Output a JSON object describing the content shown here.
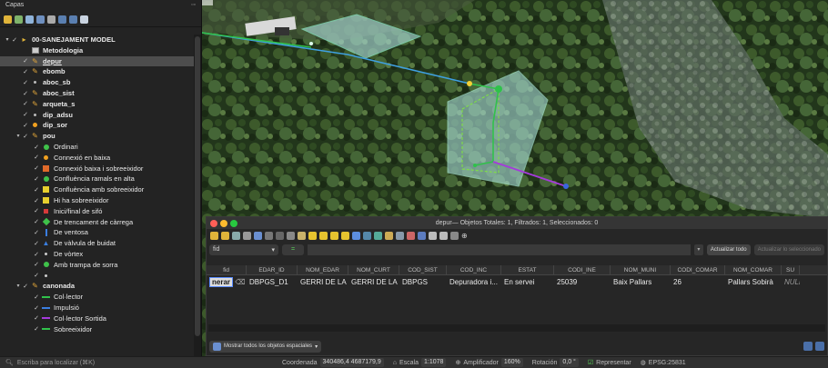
{
  "layers_panel": {
    "title": "Capas",
    "tree": [
      {
        "label": "00-SANEJAMENT MODEL",
        "indent": 0,
        "twisty": "▾",
        "check": "✓",
        "sym": "folder",
        "bold": true
      },
      {
        "label": "Metodologia",
        "indent": 1,
        "twisty": "",
        "check": "",
        "sym": "table",
        "bold": true
      },
      {
        "label": "depur",
        "indent": 1,
        "twisty": "",
        "check": "✓",
        "sym": "pencil",
        "bold": true,
        "selected": true,
        "underline": true
      },
      {
        "label": "ebomb",
        "indent": 1,
        "twisty": "",
        "check": "✓",
        "sym": "pencil",
        "bold": true
      },
      {
        "label": "aboc_sb",
        "indent": 1,
        "twisty": "",
        "check": "✓",
        "sym": "dot",
        "bold": true
      },
      {
        "label": "aboc_sist",
        "indent": 1,
        "twisty": "",
        "check": "✓",
        "sym": "pencil",
        "bold": true
      },
      {
        "label": "arqueta_s",
        "indent": 1,
        "twisty": "",
        "check": "✓",
        "sym": "pencil",
        "bold": true
      },
      {
        "label": "dip_adsu",
        "indent": 1,
        "twisty": "",
        "check": "✓",
        "sym": "dot",
        "bold": true
      },
      {
        "label": "dip_sor",
        "indent": 1,
        "twisty": "",
        "check": "✓",
        "sym": "dot-orange",
        "bold": true
      },
      {
        "label": "pou",
        "indent": 1,
        "twisty": "▾",
        "check": "✓",
        "sym": "pencil",
        "bold": true
      },
      {
        "label": "Ordinari",
        "indent": 2,
        "twisty": "",
        "check": "✓",
        "sym": "dot-green",
        "bold": false
      },
      {
        "label": "Connexió en baixa",
        "indent": 2,
        "twisty": "",
        "check": "✓",
        "sym": "dot-orange",
        "bold": false
      },
      {
        "label": "Connexió baixa i sobreeixidor",
        "indent": 2,
        "twisty": "",
        "check": "✓",
        "sym": "sq-orange",
        "bold": false
      },
      {
        "label": "Confluència ramals en alta",
        "indent": 2,
        "twisty": "",
        "check": "✓",
        "sym": "dot-green",
        "bold": false
      },
      {
        "label": "Confluència amb sobreeixidor",
        "indent": 2,
        "twisty": "",
        "check": "✓",
        "sym": "sq-yellow",
        "bold": false
      },
      {
        "label": "Hi ha sobreeixidor",
        "indent": 2,
        "twisty": "",
        "check": "✓",
        "sym": "sq-yellow",
        "bold": false
      },
      {
        "label": "Inici/final de sifó",
        "indent": 2,
        "twisty": "",
        "check": "✓",
        "sym": "x-red",
        "bold": false
      },
      {
        "label": "De trencament de càrrega",
        "indent": 2,
        "twisty": "",
        "check": "✓",
        "sym": "diamond-green",
        "bold": false
      },
      {
        "label": "De ventosa",
        "indent": 2,
        "twisty": "",
        "check": "✓",
        "sym": "bar-blue",
        "bold": false
      },
      {
        "label": "De vàlvula de buidat",
        "indent": 2,
        "twisty": "",
        "check": "✓",
        "sym": "tri-blue",
        "bold": false
      },
      {
        "label": "De vòrtex",
        "indent": 2,
        "twisty": "",
        "check": "✓",
        "sym": "dot-small",
        "bold": false
      },
      {
        "label": "Amb trampa de sorra",
        "indent": 2,
        "twisty": "",
        "check": "✓",
        "sym": "dot-green",
        "bold": false
      },
      {
        "label": "",
        "indent": 2,
        "twisty": "",
        "check": "✓",
        "sym": "dot-small",
        "bold": false
      },
      {
        "label": "canonada",
        "indent": 1,
        "twisty": "▾",
        "check": "✓",
        "sym": "pencil-line",
        "bold": true
      },
      {
        "label": "Col·lector",
        "indent": 2,
        "twisty": "",
        "check": "✓",
        "sym": "line-green",
        "bold": false
      },
      {
        "label": "Impulsió",
        "indent": 2,
        "twisty": "",
        "check": "✓",
        "sym": "line-blue",
        "bold": false
      },
      {
        "label": "Col·lector Sortida",
        "indent": 2,
        "twisty": "",
        "check": "✓",
        "sym": "line-purple",
        "bold": false
      },
      {
        "label": "Sobreeixidor",
        "indent": 2,
        "twisty": "",
        "check": "✓",
        "sym": "line-dash",
        "bold": false
      }
    ]
  },
  "attribute_table": {
    "title": "depur— Objetos Totales: 1, Filtrados: 1, Seleccionados: 0",
    "field_combo": "fid",
    "equals": "=",
    "update_all": "Actualizar todo",
    "update_selected": "Actualizar lo seleccionado",
    "columns": [
      {
        "label": "fid",
        "w": 44
      },
      {
        "label": "EDAR_ID",
        "w": 56
      },
      {
        "label": "NOM_EDAR",
        "w": 56
      },
      {
        "label": "NOM_CURT",
        "w": 56
      },
      {
        "label": "COD_SIST",
        "w": 52
      },
      {
        "label": "COD_INC",
        "w": 60
      },
      {
        "label": "ESTAT",
        "w": 58
      },
      {
        "label": "CODI_INE",
        "w": 62
      },
      {
        "label": "NOM_MUNI",
        "w": 66
      },
      {
        "label": "CODI_COMAR",
        "w": 60
      },
      {
        "label": "NOM_COMAR",
        "w": 62
      },
      {
        "label": "SU",
        "w": 20
      }
    ],
    "row": [
      "nerar",
      "DBPGS_D1",
      "GERRI DE LA ...",
      "GERRI DE LA ...",
      "DBPGS",
      "Depuradora i...",
      "En servei",
      "25039",
      "Baix Pallars",
      "26",
      "Pallars Sobirà",
      "NULL"
    ],
    "show_all_button": "Mostrar todos los objetos espaciales"
  },
  "status_bar": {
    "locate_placeholder": "Escriba para localizar (⌘K)",
    "coordinate_label": "Coordenada",
    "coordinate_value": "340486,4 4687179,9",
    "scale_label": "Escala",
    "scale_value": "1:1078",
    "magnifier_label": "Amplificador",
    "magnifier_value": "160%",
    "rotation_label": "Rotación",
    "rotation_value": "0,0 °",
    "render_label": "Representar",
    "crs_value": "EPSG:25831"
  }
}
